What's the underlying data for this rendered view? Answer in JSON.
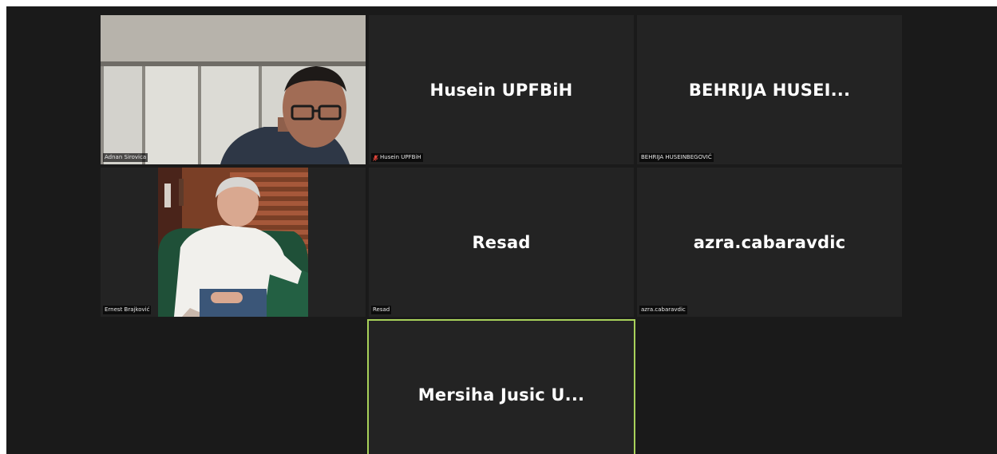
{
  "participants": [
    {
      "name": "Adnan Sirovica",
      "display_label": "Adnan Sirovica",
      "video": true,
      "muted": false
    },
    {
      "name": "Husein UPFBiH",
      "display_label": "Husein UPFBiH",
      "video": false,
      "muted": true
    },
    {
      "name": "BEHRIJA  HUSEI...",
      "display_label": "BEHRIJA HUSEINBEGOVIĆ",
      "video": false,
      "muted": false
    },
    {
      "name": "Ernest Brajković",
      "display_label": "Ernest Brajković",
      "video": true,
      "muted": false
    },
    {
      "name": "Resad",
      "display_label": "Resad",
      "video": false,
      "muted": false
    },
    {
      "name": "azra.cabaravdic",
      "display_label": "azra.cabaravdic",
      "video": false,
      "muted": false
    },
    {
      "name": "Mersiha  Jusic  U...",
      "display_label": "",
      "video": false,
      "muted": false,
      "active_speaker": true
    }
  ],
  "colors": {
    "background": "#1a1a1a",
    "tile": "#232323",
    "active_speaker_border": "#a8d15a",
    "muted_icon": "#e0453a"
  },
  "icons": {
    "muted": "mic-muted-icon"
  }
}
